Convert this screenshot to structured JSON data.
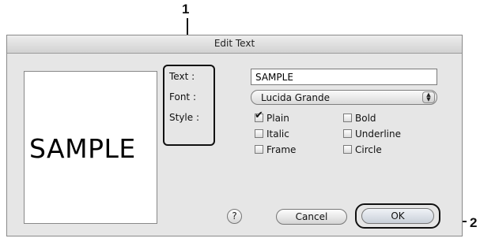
{
  "callouts": {
    "one": "1",
    "two": "2"
  },
  "dialog": {
    "title": "Edit Text",
    "preview_text": "SAMPLE",
    "labels": {
      "text": "Text :",
      "font": "Font :",
      "style": "Style :"
    },
    "text_value": "SAMPLE",
    "font_value": "Lucida Grande",
    "styles": [
      {
        "label": "Plain",
        "checked": true
      },
      {
        "label": "Bold",
        "checked": false
      },
      {
        "label": "Italic",
        "checked": false
      },
      {
        "label": "Underline",
        "checked": false
      },
      {
        "label": "Frame",
        "checked": false
      },
      {
        "label": "Circle",
        "checked": false
      }
    ],
    "help_symbol": "?",
    "cancel_label": "Cancel",
    "ok_label": "OK"
  }
}
